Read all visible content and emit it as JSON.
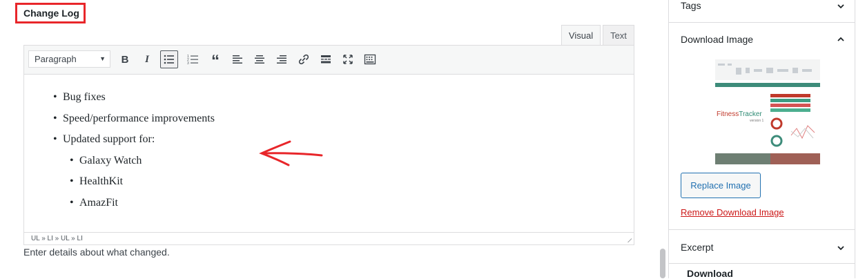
{
  "main": {
    "heading": "Change Log",
    "tabs": [
      {
        "label": "Visual"
      },
      {
        "label": "Text"
      }
    ],
    "format_select": {
      "value": "Paragraph"
    },
    "toolbar_icons": [
      "bold-icon",
      "italic-icon",
      "bullet-list-icon",
      "numbered-list-icon",
      "blockquote-icon",
      "align-left-icon",
      "align-center-icon",
      "align-right-icon",
      "link-icon",
      "read-more-icon",
      "fullscreen-icon",
      "toolbar-toggle-icon"
    ],
    "content": {
      "items": [
        "Bug fixes",
        "Speed/performance improvements",
        "Updated support for:"
      ],
      "subitems": [
        "Galaxy Watch",
        "HealthKit",
        "AmazFit"
      ]
    },
    "status_path": "UL » LI » UL » LI",
    "help_text": "Enter details about what changed.",
    "annotation_color": "#e8262a"
  },
  "sidebar": {
    "tags_title": "Tags",
    "download_image_title": "Download Image",
    "thumbnail_text": {
      "brand_a": "Fitness",
      "brand_b": "Tracker",
      "version": "version 1"
    },
    "replace_label": "Replace Image",
    "remove_label": "Remove Download Image",
    "excerpt_title": "Excerpt",
    "download_label": "Download"
  }
}
